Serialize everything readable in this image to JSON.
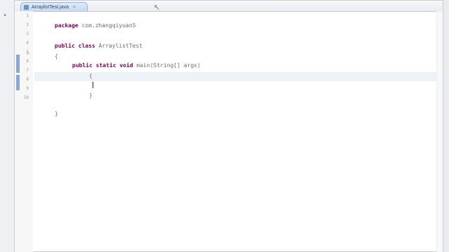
{
  "editor": {
    "tab_label": "ArraylistTest.java",
    "close_glyph": "×"
  },
  "code": {
    "line1_kw": "package",
    "line1_rest": " com.zhangqiyuan5",
    "line2_kw": "public class",
    "line2_rest": " ArraylistTest",
    "line3": "{",
    "line4_kw": "public static void",
    "line4_rest": " main(String[] args)",
    "line5": "{",
    "line7": "}",
    "line9": "}"
  },
  "gutter": {
    "numbers": [
      "1",
      "2",
      "3",
      "4",
      "5",
      "6",
      "7",
      "8",
      "9",
      "10"
    ],
    "fold_glyph": "⊖"
  },
  "colors": {
    "keyword": "#7f0055",
    "plain": "#6e6e6e",
    "editor_bg": "#ffffff"
  }
}
